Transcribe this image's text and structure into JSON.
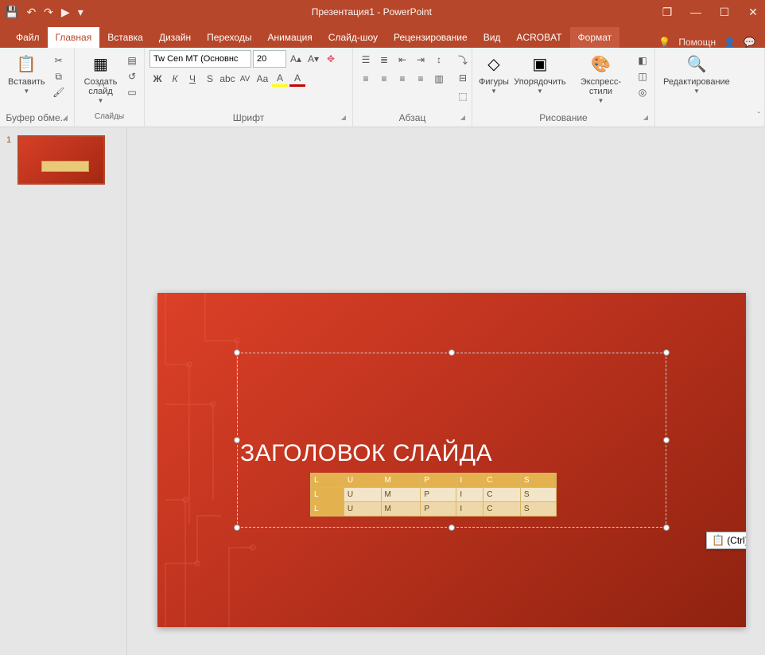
{
  "title": "Презентация1 - PowerPoint",
  "qat": {
    "save": "💾",
    "undo": "↶",
    "redo": "↷",
    "start": "▶",
    "more": "▾"
  },
  "win": {
    "restore": "❐",
    "min": "—",
    "max": "☐",
    "close": "✕"
  },
  "tabs": [
    "Файл",
    "Главная",
    "Вставка",
    "Дизайн",
    "Переходы",
    "Анимация",
    "Слайд-шоу",
    "Рецензирование",
    "Вид",
    "ACROBAT"
  ],
  "ctx_tab": "Формат",
  "help": "Помощн",
  "ribbon": {
    "clipboard": {
      "paste": "Вставить",
      "label": "Буфер обме..."
    },
    "slides": {
      "new": "Создать слайд",
      "label": "Слайды"
    },
    "font": {
      "name": "Tw Cen MT (Основнс",
      "size": "20",
      "label": "Шрифт"
    },
    "para": {
      "label": "Абзац"
    },
    "drawing": {
      "shapes": "Фигуры",
      "arrange": "Упорядочить",
      "styles": "Экспресс-стили",
      "label": "Рисование"
    },
    "editing": {
      "label": "Редактирование"
    }
  },
  "thumb": {
    "num": "1"
  },
  "slide": {
    "title": "ЗАГОЛОВОК СЛАЙДА"
  },
  "table": {
    "rows": [
      [
        "L",
        "U",
        "M",
        "P",
        "I",
        "C",
        "S"
      ],
      [
        "L",
        "U",
        "M",
        "P",
        "I",
        "C",
        "S"
      ],
      [
        "L",
        "U",
        "M",
        "P",
        "I",
        "C",
        "S"
      ]
    ]
  },
  "pasteopts": {
    "label": "(Ctrl)"
  }
}
